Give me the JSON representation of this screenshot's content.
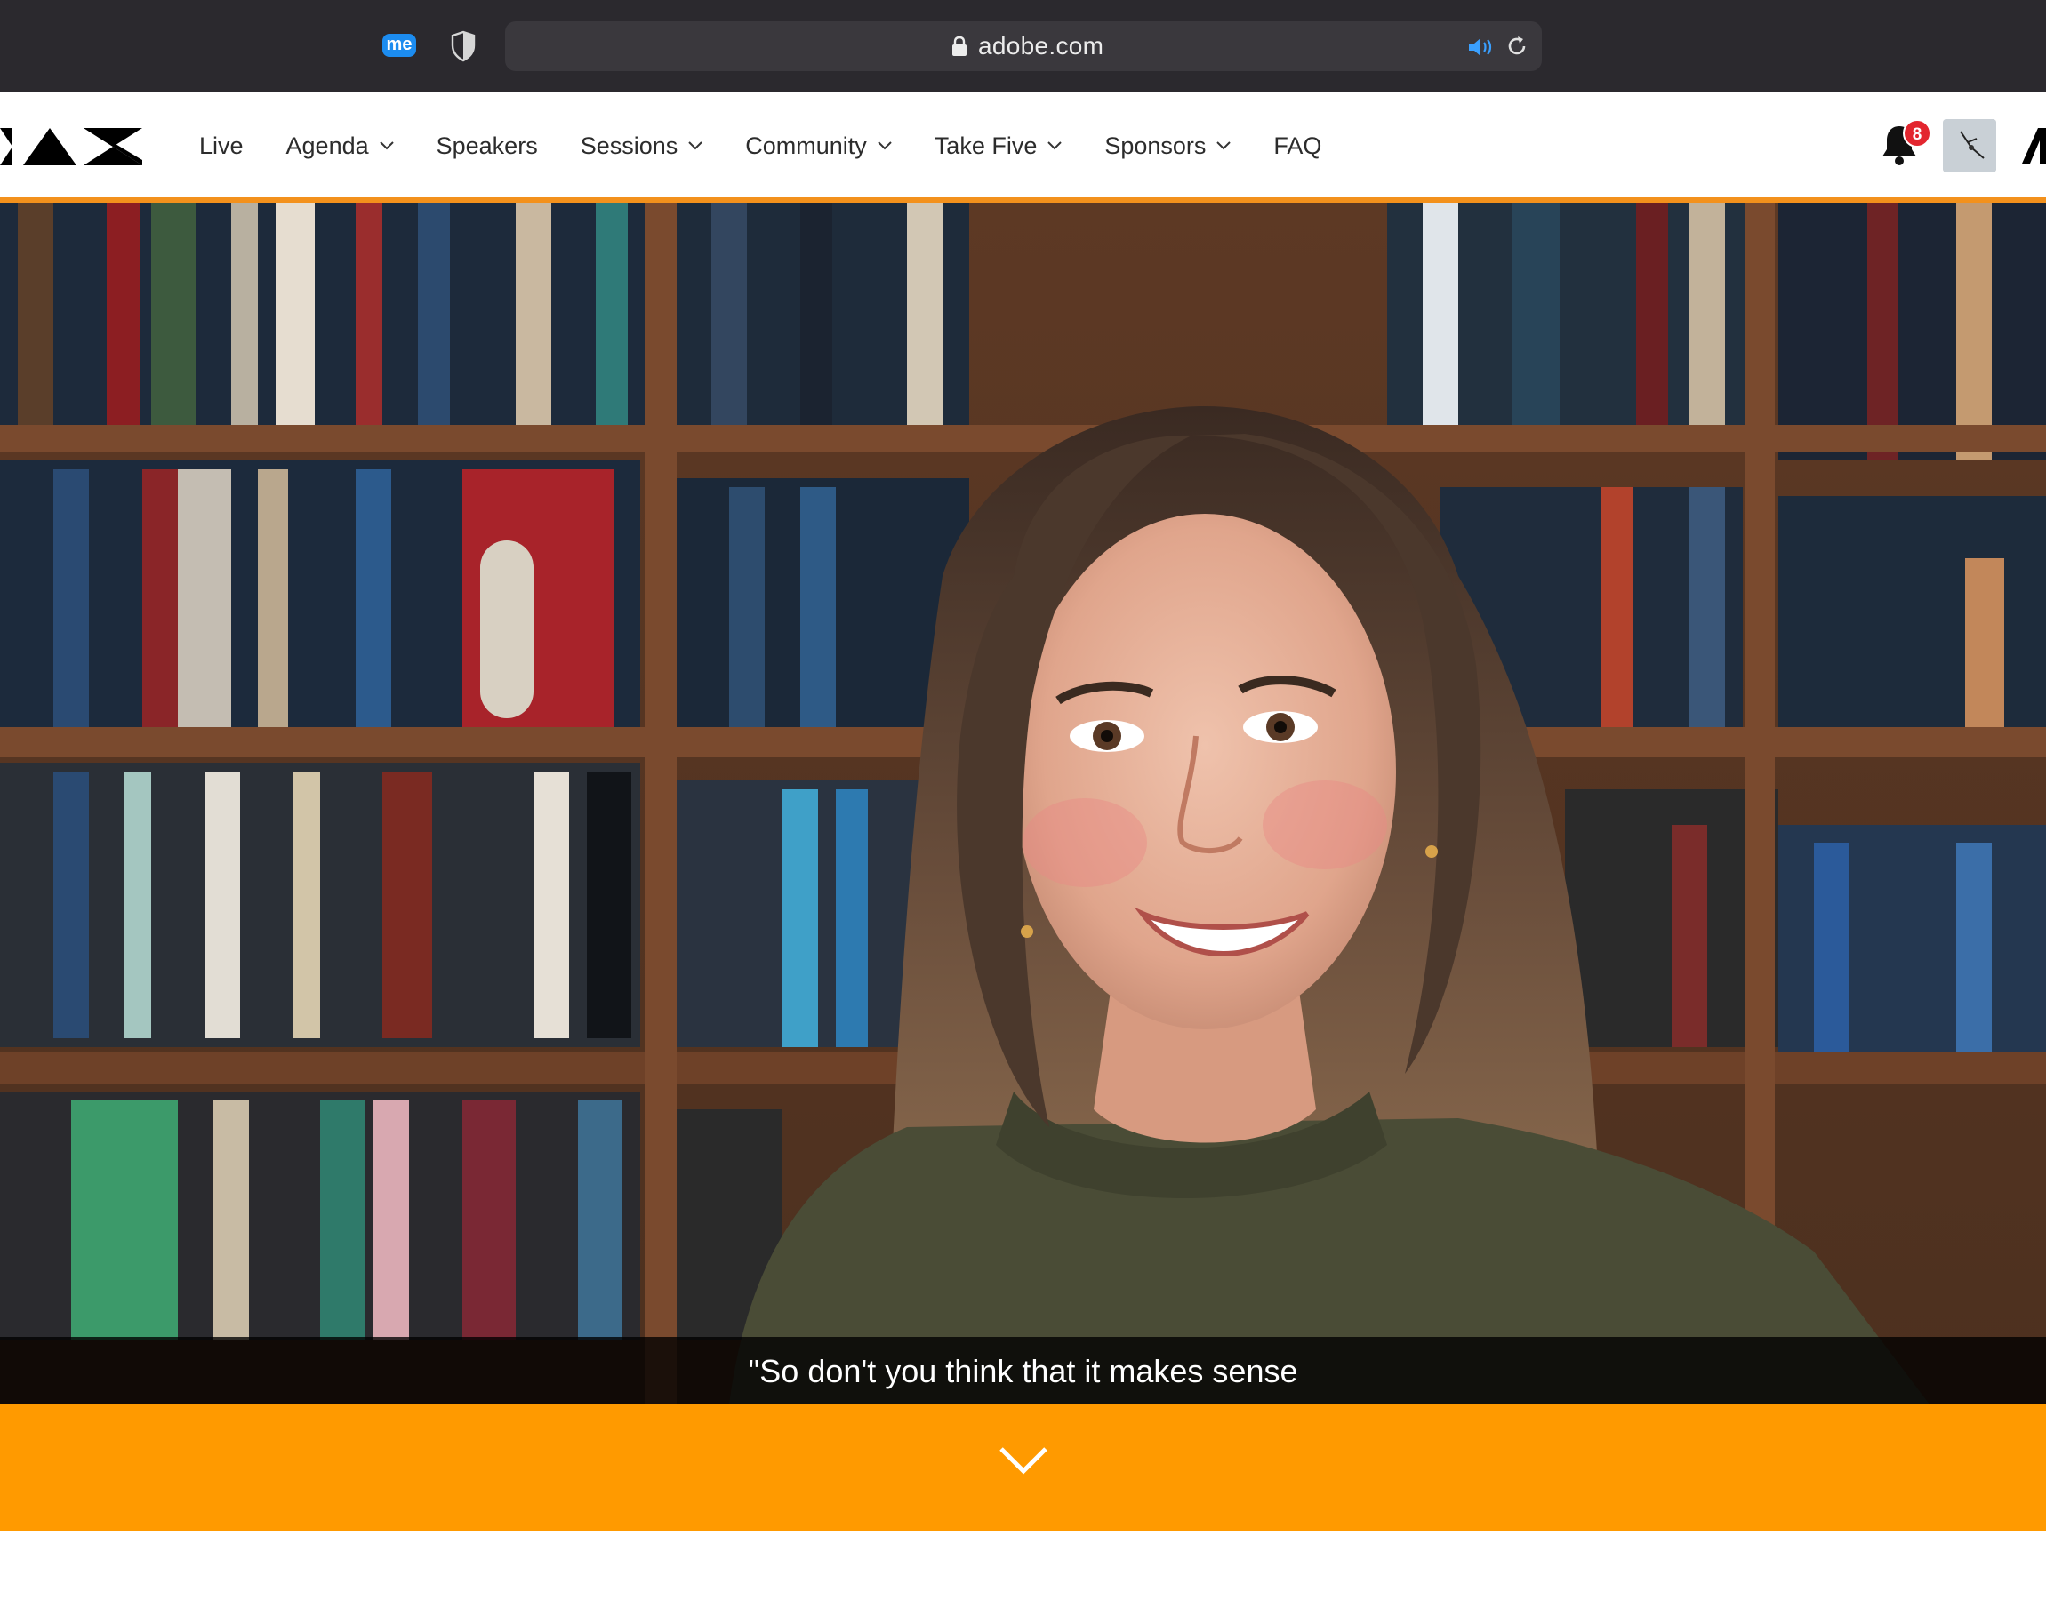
{
  "browser": {
    "url": "adobe.com",
    "extensions": [
      {
        "name": "me-extension",
        "label": "me"
      },
      {
        "name": "privacy-shield"
      }
    ],
    "icons": [
      "lock-icon",
      "audio-playing-icon",
      "reload-icon"
    ]
  },
  "site": {
    "nav": {
      "items": [
        {
          "label": "Live",
          "has_dropdown": false
        },
        {
          "label": "Agenda",
          "has_dropdown": true
        },
        {
          "label": "Speakers",
          "has_dropdown": false
        },
        {
          "label": "Sessions",
          "has_dropdown": true
        },
        {
          "label": "Community",
          "has_dropdown": true
        },
        {
          "label": "Take Five",
          "has_dropdown": true
        },
        {
          "label": "Sponsors",
          "has_dropdown": true
        },
        {
          "label": "FAQ",
          "has_dropdown": false
        }
      ],
      "notifications_count": "8"
    }
  },
  "hero": {
    "caption": "\"So don't you think that it makes sense"
  },
  "colors": {
    "chrome_bg": "#2b292e",
    "urlbar_bg": "#3a383d",
    "accent_orange": "#ff9a00",
    "progress_orange": "#f3911c",
    "badge_red": "#e3262f"
  }
}
